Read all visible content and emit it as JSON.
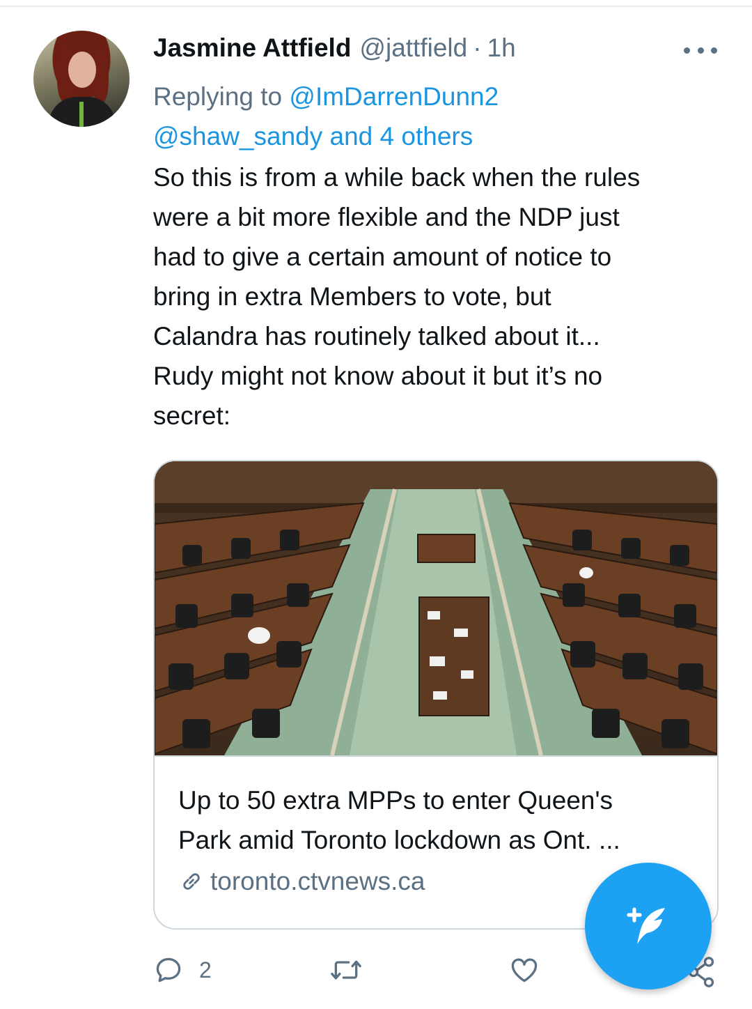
{
  "tweet": {
    "display_name": "Jasmine Attfield",
    "handle": "@jattfield",
    "separator": "·",
    "time": "1h",
    "replying_prefix": "Replying to",
    "reply_mention_1": "@ImDarrenDunn2",
    "reply_mention_2": "@shaw_sandy and 4 others",
    "text_lines": [
      "So this is from a while back when the rules",
      "were a bit more flexible and the NDP just",
      "had to give a certain amount of notice to",
      "bring in extra Members to vote, but",
      "Calandra has routinely talked about it...",
      "Rudy might not know about it but it’s no",
      "secret:"
    ]
  },
  "card": {
    "title_lines": [
      "Up to 50 extra MPPs to enter Queen's",
      "Park amid Toronto lockdown as Ont. ..."
    ],
    "domain": "toronto.ctvnews.ca",
    "link_icon": "link-icon"
  },
  "actions": {
    "reply_count": "2",
    "icons": [
      "reply-icon",
      "retweet-icon",
      "like-icon",
      "share-icon"
    ]
  },
  "fab": {
    "icon": "compose-tweet-icon"
  },
  "colors": {
    "accent": "#1da1f2",
    "link": "#1b95e0",
    "secondary_text": "#5b7083",
    "border": "#ccd6dd"
  }
}
